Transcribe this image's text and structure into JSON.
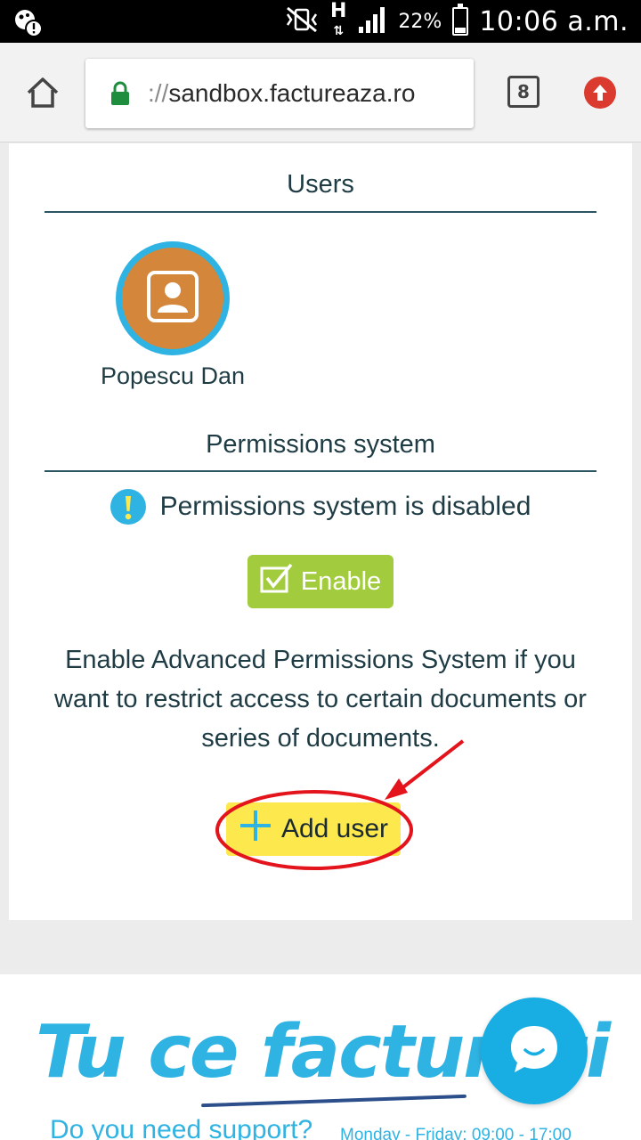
{
  "status_bar": {
    "battery_percent": "22%",
    "time": "10:06 a.m.",
    "network_type": "H"
  },
  "browser": {
    "url_scheme": "://",
    "url_host": "sandbox.factureaza.ro",
    "tab_count": "8"
  },
  "users_section": {
    "title": "Users",
    "users": [
      {
        "name": "Popescu Dan"
      }
    ]
  },
  "permissions_section": {
    "title": "Permissions system",
    "status_text": "Permissions system is disabled",
    "enable_label": "Enable",
    "description": "Enable Advanced Permissions System if you want to restrict access to certain documents or series of documents.",
    "add_user_label": "Add user"
  },
  "footer": {
    "brand": "Tu ce facturezi",
    "support_text": "Do you need support?",
    "hours_text": "Monday - Friday: 09:00 - 17:00"
  },
  "colors": {
    "accent_blue": "#2fb3e3",
    "enable_green": "#a2cc3e",
    "add_user_yellow": "#fde84e",
    "avatar_orange": "#d4873a",
    "annotation_red": "#e3141b"
  }
}
